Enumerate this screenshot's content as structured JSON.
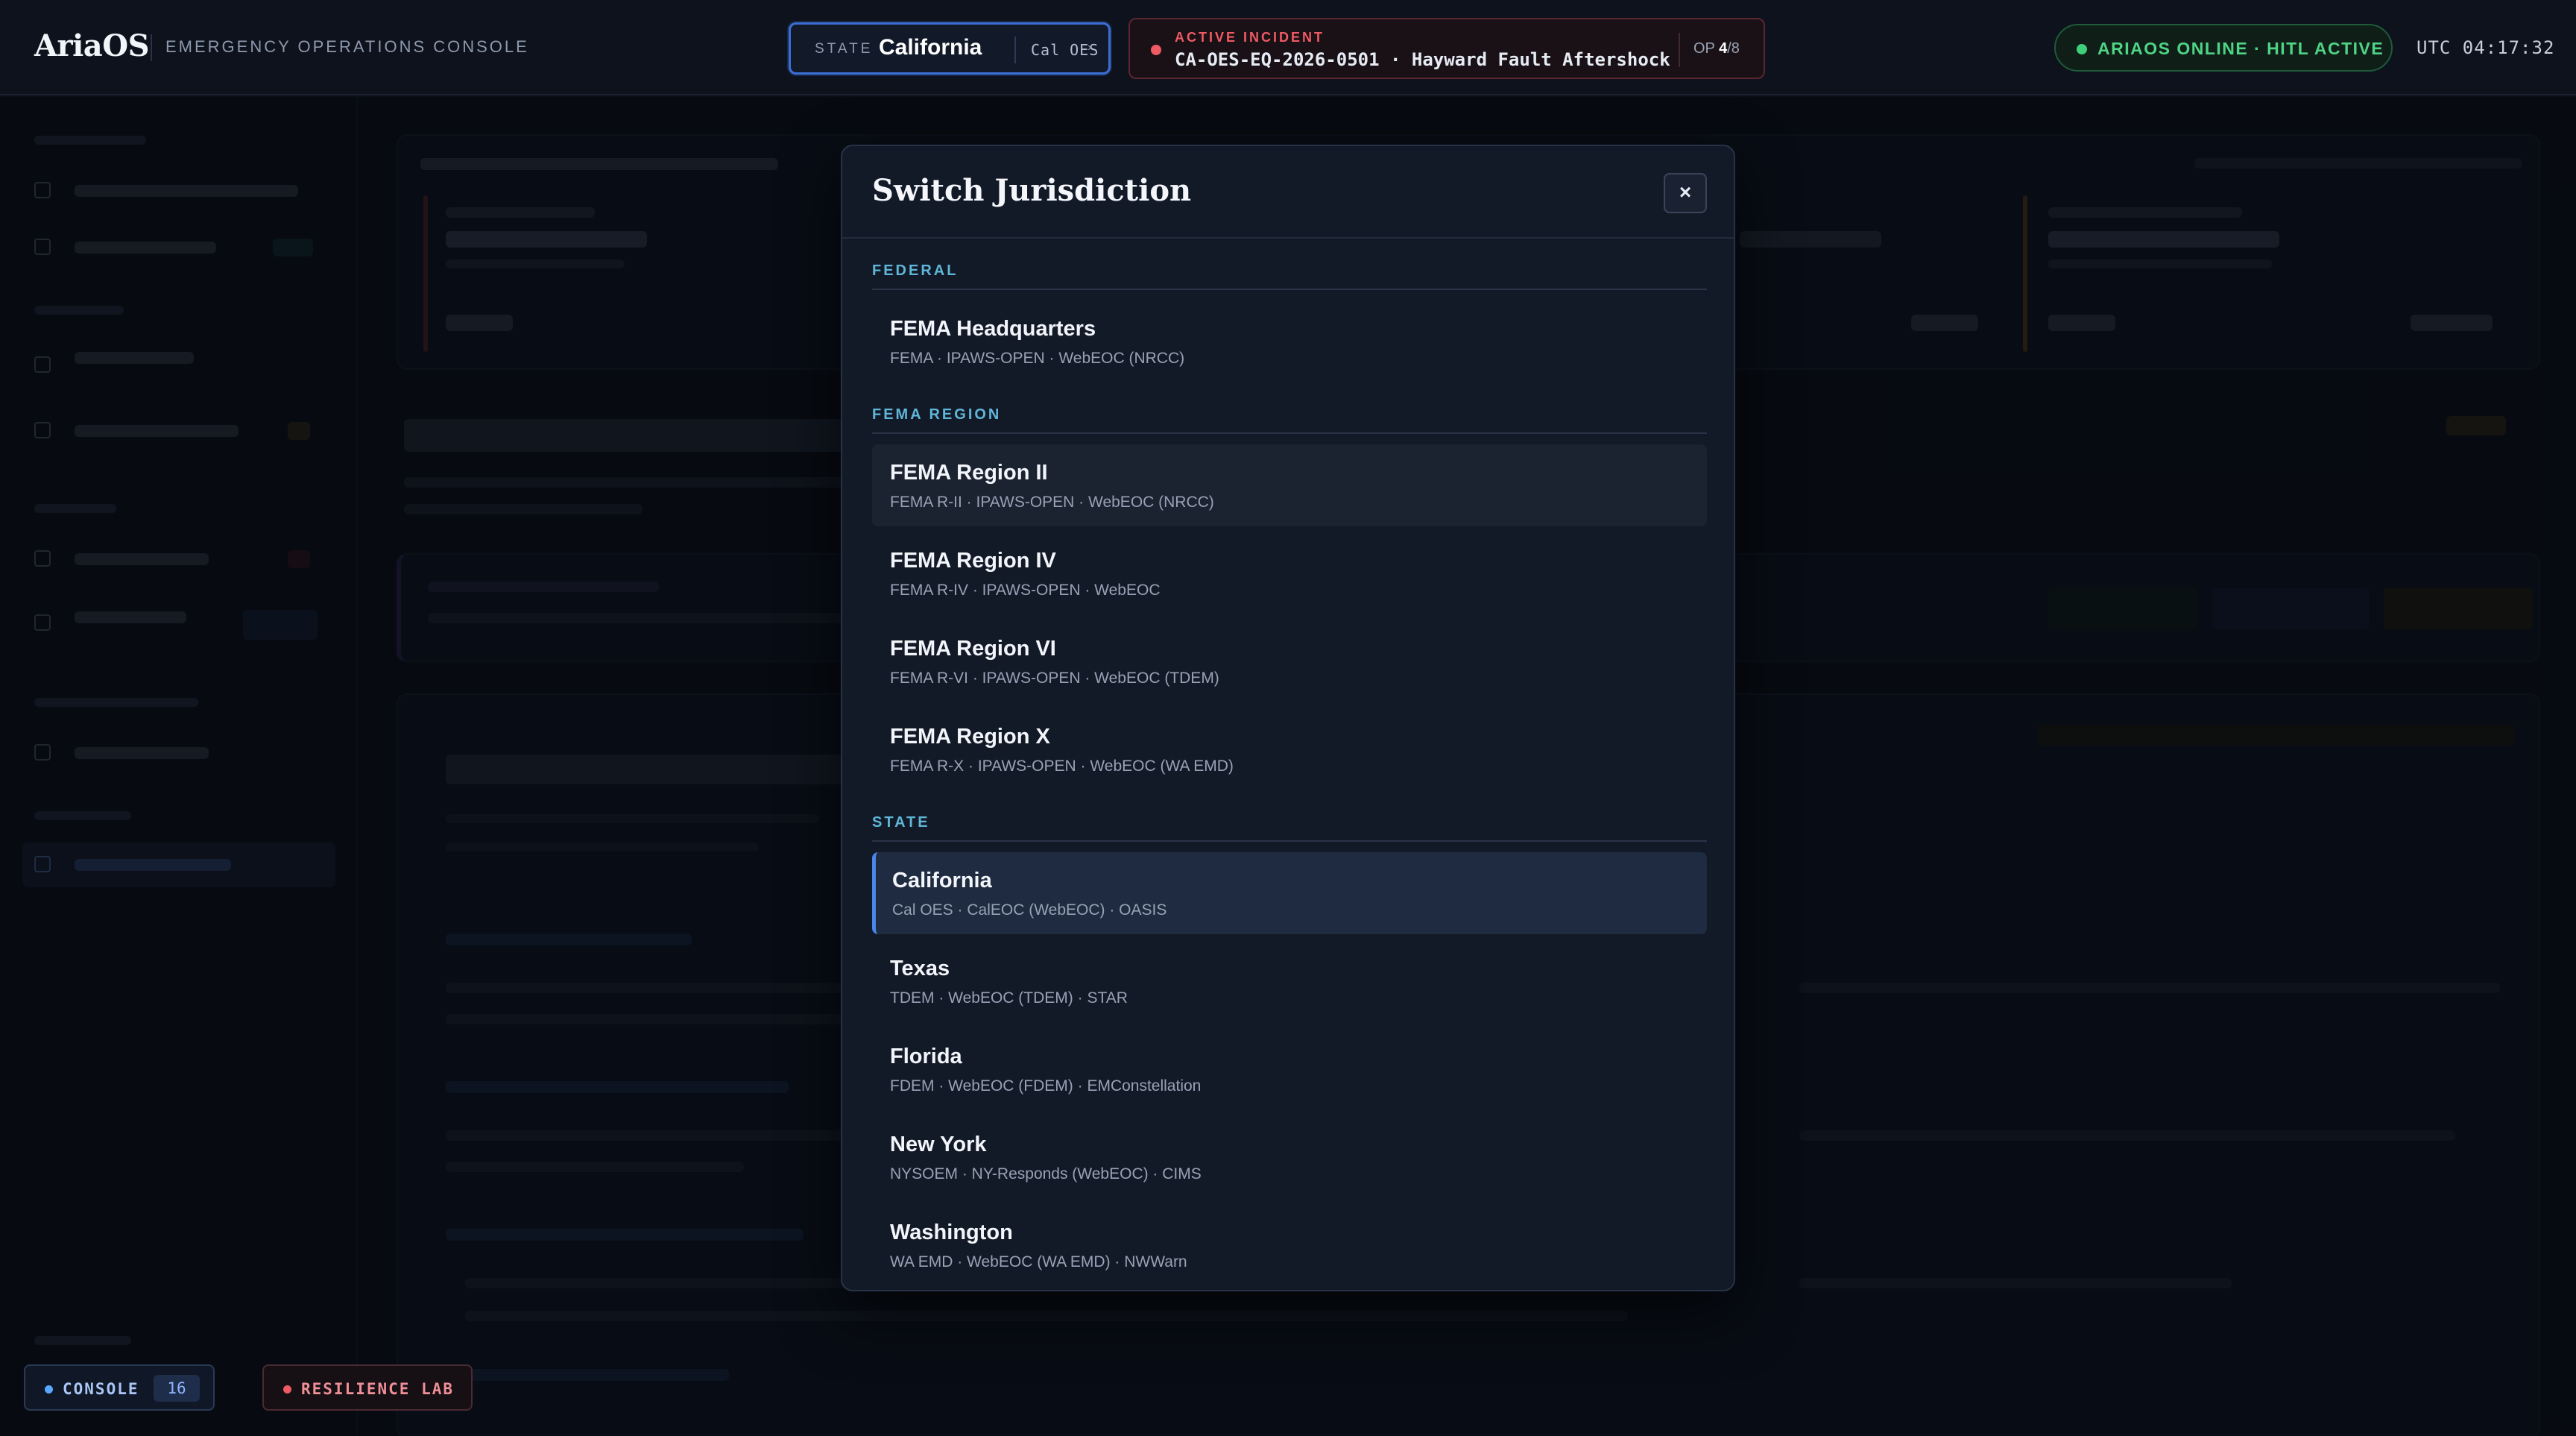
{
  "topbar": {
    "brand": "AriaOS",
    "subtitle": "EMERGENCY OPERATIONS CONSOLE",
    "state_label": "STATE",
    "state_value": "California",
    "state_org": "Cal OES",
    "incident_label": "ACTIVE INCIDENT",
    "incident_value": "CA-OES-EQ-2026-0501 · Hayward Fault Aftershock",
    "op_prefix": "OP",
    "op_current": "4",
    "op_total": "/8",
    "status": "ARIAOS ONLINE · HITL ACTIVE",
    "utc": "UTC 04:17:32"
  },
  "footer": {
    "console_label": "CONSOLE",
    "console_count": "16",
    "lab_label": "RESILIENCE LAB"
  },
  "modal": {
    "title": "Switch Jurisdiction",
    "close": "×",
    "groups": [
      {
        "caption": "FEDERAL",
        "options": [
          {
            "name": "FEMA Headquarters",
            "meta": "FEMA · IPAWS-OPEN · WebEOC (NRCC)"
          }
        ]
      },
      {
        "caption": "FEMA REGION",
        "options": [
          {
            "name": "FEMA Region II",
            "meta": "FEMA R-II · IPAWS-OPEN · WebEOC (NRCC)"
          },
          {
            "name": "FEMA Region IV",
            "meta": "FEMA R-IV · IPAWS-OPEN · WebEOC"
          },
          {
            "name": "FEMA Region VI",
            "meta": "FEMA R-VI · IPAWS-OPEN · WebEOC (TDEM)"
          },
          {
            "name": "FEMA Region X",
            "meta": "FEMA R-X · IPAWS-OPEN · WebEOC (WA EMD)"
          }
        ]
      },
      {
        "caption": "STATE",
        "options": [
          {
            "name": "California",
            "meta": "Cal OES · CalEOC (WebEOC) · OASIS"
          },
          {
            "name": "Texas",
            "meta": "TDEM · WebEOC (TDEM) · STAR"
          },
          {
            "name": "Florida",
            "meta": "FDEM · WebEOC (FDEM) · EMConstellation"
          },
          {
            "name": "New York",
            "meta": "NYSOEM · NY-Responds (WebEOC) · CIMS"
          },
          {
            "name": "Washington",
            "meta": "WA EMD · WebEOC (WA EMD) · NWWarn"
          }
        ]
      }
    ]
  },
  "colors": {
    "accent": "#4a86ec",
    "incident": "#ef5a64",
    "online": "#4fd486",
    "group_caption": "#5fb6d8"
  }
}
